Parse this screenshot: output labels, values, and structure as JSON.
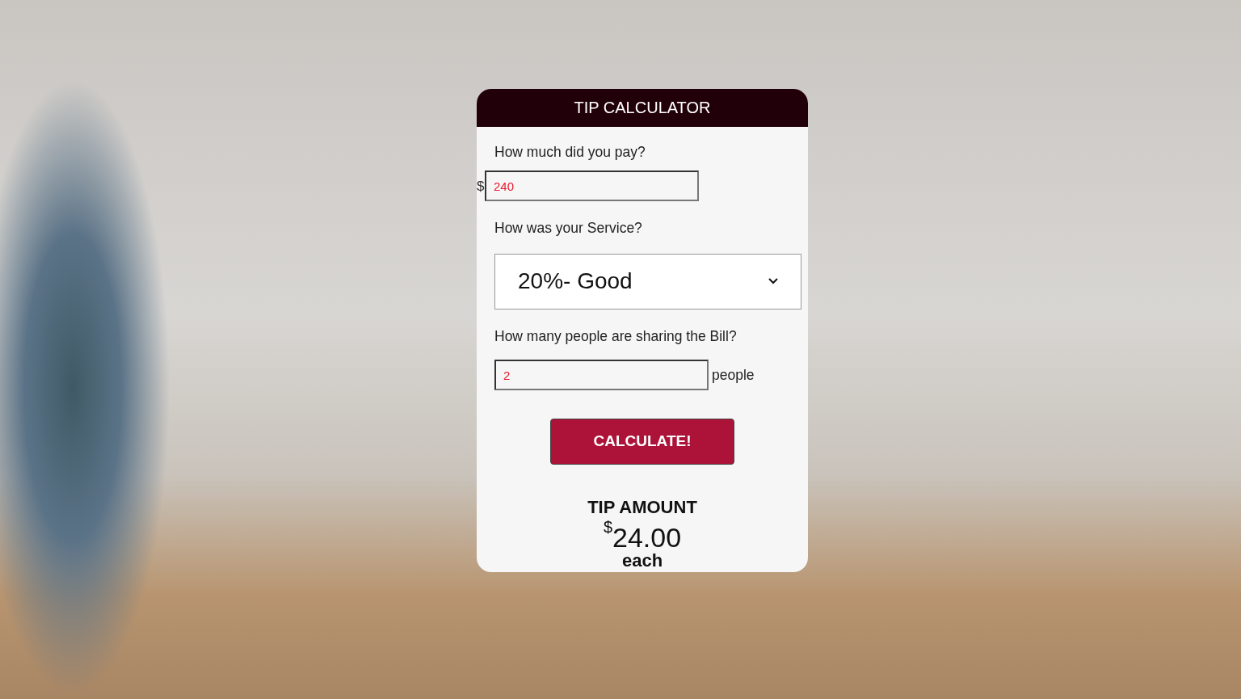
{
  "title": "TIP CALCULATOR",
  "bill": {
    "label": "How much did you pay?",
    "prefix": "$",
    "value": "240"
  },
  "service": {
    "label": "How was your Service?",
    "value": "20%- Good"
  },
  "people": {
    "label": "How many people are sharing the Bill?",
    "value": "2",
    "suffix": "people"
  },
  "button": "CALCULATE!",
  "result": {
    "heading": "TIP AMOUNT",
    "currency": "$",
    "amount": "24.00",
    "unit": "each"
  }
}
